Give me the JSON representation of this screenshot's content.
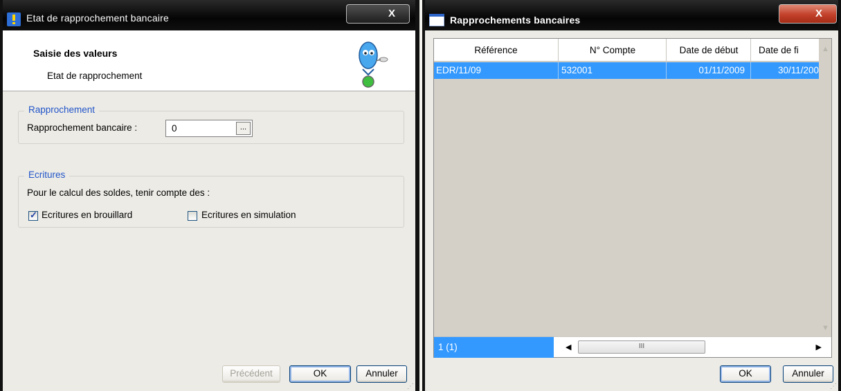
{
  "left_window": {
    "title": "Etat de rapprochement bancaire",
    "close_label": "X",
    "header": {
      "title": "Saisie des valeurs",
      "subtitle": "Etat de rapprochement"
    },
    "group_rapprochement": {
      "legend": "Rapprochement",
      "field_label": "Rapprochement bancaire :",
      "field_value": "0",
      "lookup_label": "..."
    },
    "group_ecritures": {
      "legend": "Ecritures",
      "description": "Pour le calcul des soldes, tenir compte des :",
      "checkbox_brouillard": {
        "label": "Ecritures en brouillard",
        "checked": true
      },
      "checkbox_simulation": {
        "label": "Ecritures en simulation",
        "checked": false
      }
    },
    "buttons": {
      "previous": "Précédent",
      "ok": "OK",
      "cancel": "Annuler"
    }
  },
  "right_window": {
    "title": "Rapprochements bancaires",
    "close_label": "X",
    "grid": {
      "columns": [
        "Référence",
        "N° Compte",
        "Date de début",
        "Date de fi"
      ],
      "rows": [
        [
          "EDR/11/09",
          "532001",
          "01/11/2009",
          "30/11/200"
        ]
      ],
      "record_counter": "1 (1)",
      "hscroll_thumb": "III"
    },
    "buttons": {
      "ok": "OK",
      "cancel": "Annuler"
    }
  },
  "colors": {
    "selection": "#3399ff",
    "group_legend": "#2255c8",
    "close_button_red": "#c2412a"
  }
}
